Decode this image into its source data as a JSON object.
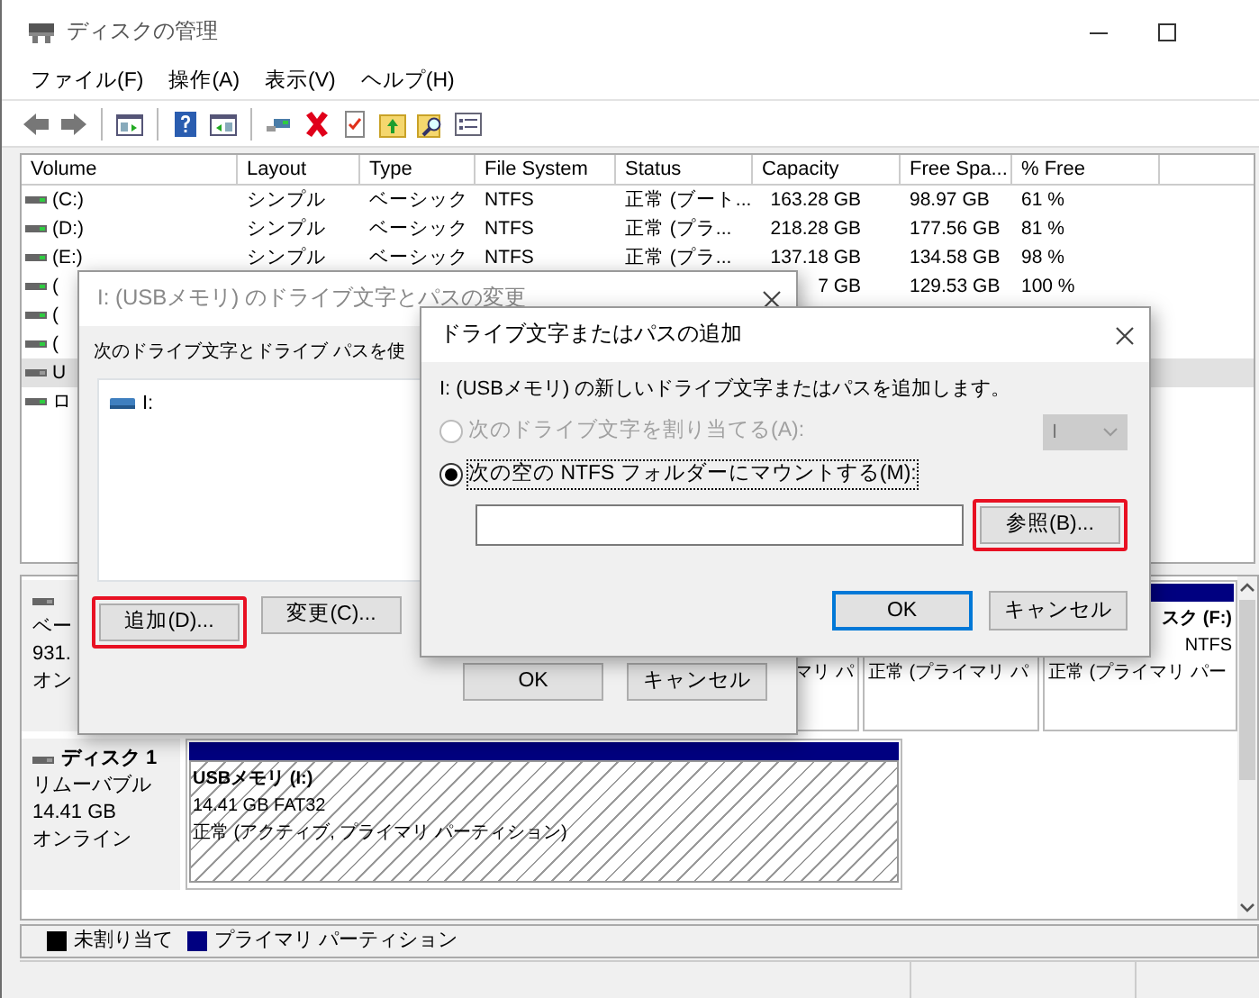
{
  "window": {
    "title": "ディスクの管理"
  },
  "menu": [
    "ファイル(F)",
    "操作(A)",
    "表示(V)",
    "ヘルプ(H)"
  ],
  "volume_table": {
    "columns": [
      "Volume",
      "Layout",
      "Type",
      "File System",
      "Status",
      "Capacity",
      "Free Spa...",
      "% Free"
    ],
    "rows": [
      {
        "selected": false,
        "volume": "(C:)",
        "layout": "シンプル",
        "type": "ベーシック",
        "file_system": "NTFS",
        "status": "正常 (ブート...",
        "capacity": "163.28 GB",
        "free_space": "98.97 GB",
        "percent_free": "61 %"
      },
      {
        "selected": false,
        "volume": "(D:)",
        "layout": "シンプル",
        "type": "ベーシック",
        "file_system": "NTFS",
        "status": "正常 (プラ...",
        "capacity": "218.28 GB",
        "free_space": "177.56 GB",
        "percent_free": "81 %"
      },
      {
        "selected": false,
        "volume": "(E:)",
        "layout": "シンプル",
        "type": "ベーシック",
        "file_system": "NTFS",
        "status": "正常 (プラ...",
        "capacity": "137.18 GB",
        "free_space": "134.58 GB",
        "percent_free": "98 %"
      },
      {
        "selected": false,
        "volume": "(",
        "capacity": "7 GB",
        "free_space": "129.53 GB",
        "percent_free": "100 %"
      },
      {
        "selected": false,
        "volume": "("
      },
      {
        "selected": false,
        "volume": "("
      },
      {
        "selected": true,
        "volume": "U"
      },
      {
        "selected": false,
        "volume": "ロ"
      }
    ]
  },
  "disks": [
    {
      "info": [
        "ベー",
        "931.",
        "オン"
      ],
      "partitions": [
        {
          "selected": false,
          "status": "マリ パ"
        },
        {
          "selected": false,
          "status": "正常 (プライマリ パ"
        },
        {
          "selected": false,
          "name": "スク (F:)",
          "size": "NTFS",
          "status": "正常 (プライマリ パー"
        }
      ]
    },
    {
      "name": "ディスク 1",
      "info": [
        "リムーバブル",
        "14.41 GB",
        "オンライン"
      ],
      "partitions": [
        {
          "selected": true,
          "name": "USBメモリ (I:)",
          "size": "14.41 GB FAT32",
          "status": "正常 (アクティブ, プライマリ パーティション)"
        }
      ]
    }
  ],
  "legend": [
    {
      "label": "未割り当て",
      "color": "#000000"
    },
    {
      "label": "プライマリ パーティション",
      "color": "#000080"
    }
  ],
  "change_dialog": {
    "title": "I: (USBメモリ) のドライブ文字とパスの変更",
    "active": false,
    "description": "次のドライブ文字とドライブ パスを使",
    "paths": [
      {
        "label": "I:"
      }
    ],
    "buttons": [
      {
        "label": "追加(D)...",
        "highlighted": true
      },
      {
        "label": "変更(C)...",
        "highlighted": false
      }
    ],
    "footer_buttons": [
      "OK",
      "キャンセル"
    ]
  },
  "add_dialog": {
    "title": "ドライブ文字またはパスの追加",
    "active": true,
    "description": "I: (USBメモリ) の新しいドライブ文字またはパスを追加します。",
    "options": [
      {
        "label": "次のドライブ文字を割り当てる(A):",
        "selected": false,
        "disabled": true,
        "focused": false
      },
      {
        "label": "次の空の NTFS フォルダーにマウントする(M):",
        "selected": true,
        "disabled": false,
        "focused": true
      }
    ],
    "drive_select": {
      "value": "I",
      "disabled": true
    },
    "browse_button": {
      "label": "参照(B)...",
      "highlighted": true
    },
    "buttons": [
      {
        "label": "OK",
        "default": true
      },
      {
        "label": "キャンセル",
        "default": false
      }
    ]
  }
}
